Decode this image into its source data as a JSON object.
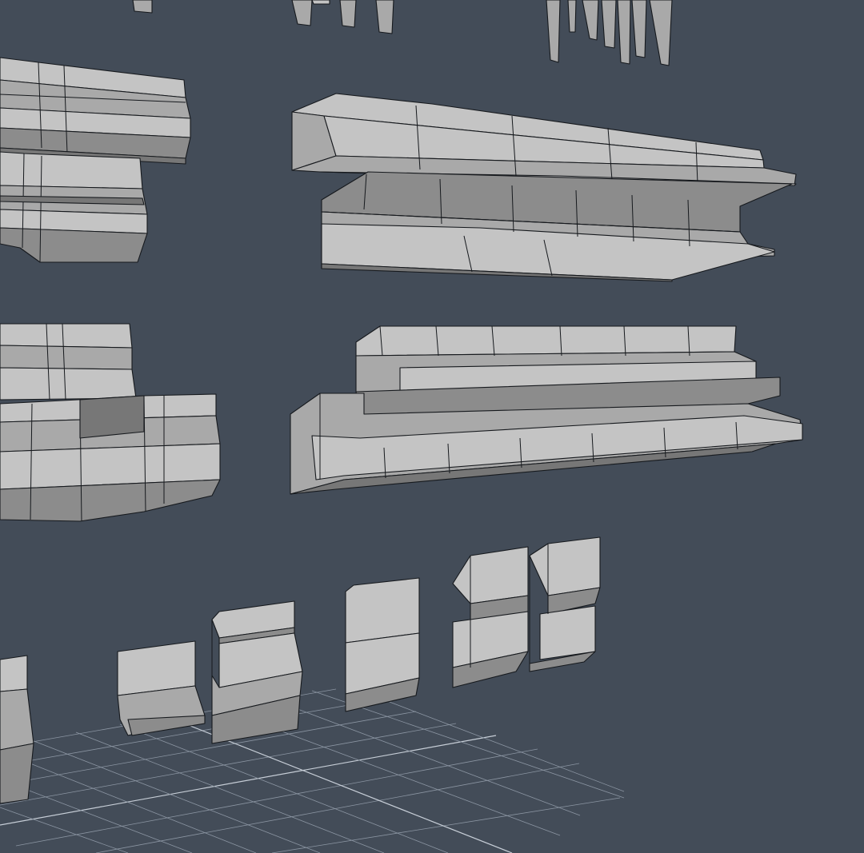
{
  "viewport": {
    "background": "#434c58",
    "shading": {
      "top_face": "#c4c4c4",
      "front_face": "#a9a9a9",
      "underside": "#777777",
      "edge": "#16191d"
    },
    "grid_color": "#8b95a2"
  }
}
